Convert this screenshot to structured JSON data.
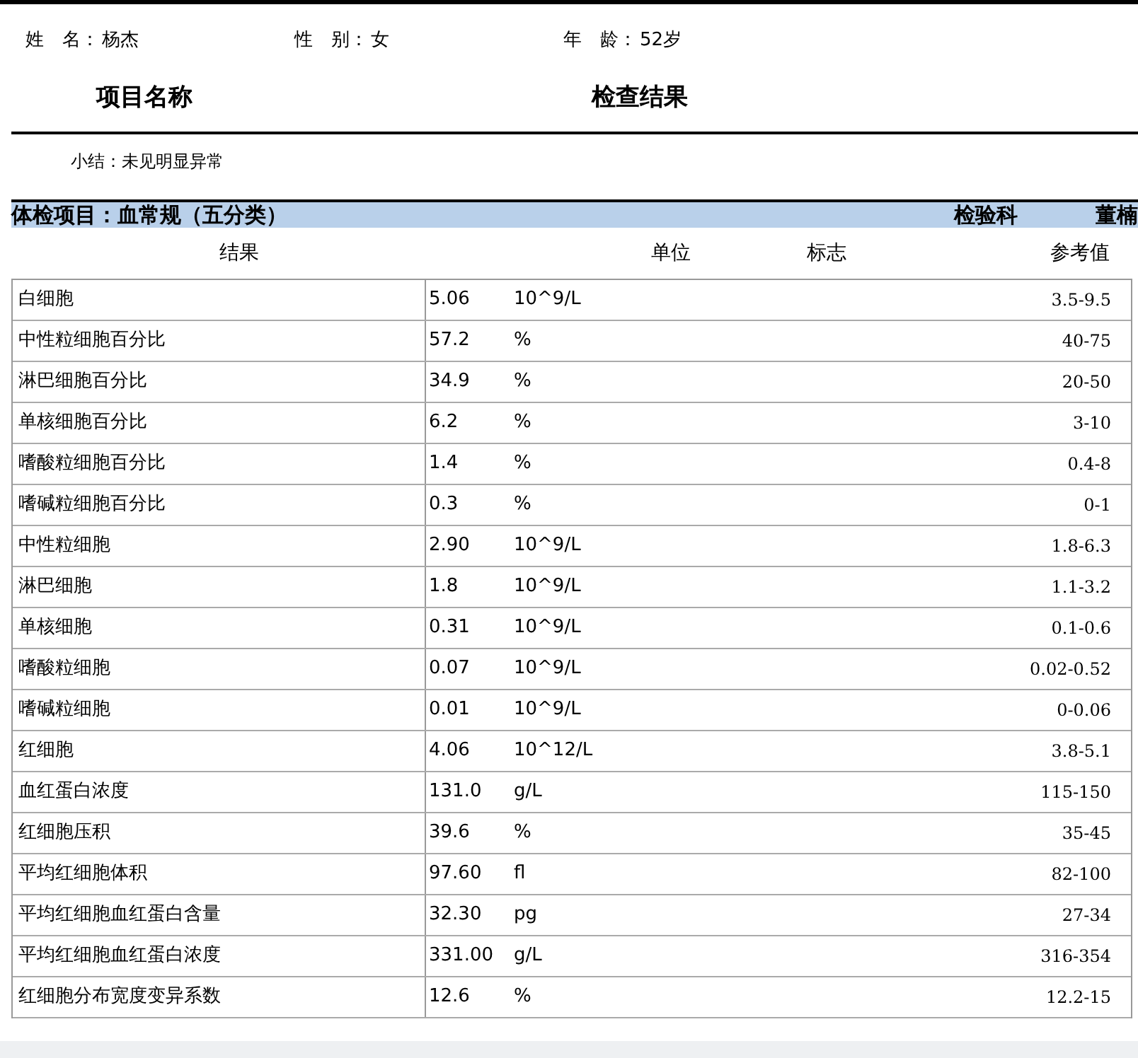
{
  "patient": [
    {
      "label": "姓　名：",
      "value": "杨杰"
    },
    {
      "label": "性　别：",
      "value": "女"
    },
    {
      "label": "年　龄：",
      "value": "52岁"
    }
  ],
  "headings": [
    "项目名称",
    "检查结果"
  ],
  "summary": "小结：未见明显异常",
  "section": {
    "title": "体检项目：血常规（五分类）",
    "department": "检验科",
    "doctor": "董楠"
  },
  "columns": [
    "结果",
    "单位",
    "标志",
    "参考值"
  ],
  "rows": [
    {
      "name": "白细胞",
      "value": "5.06",
      "unit": "10^9/L",
      "reference": "3.5-9.5"
    },
    {
      "name": "中性粒细胞百分比",
      "value": "57.2",
      "unit": "%",
      "reference": "40-75"
    },
    {
      "name": "淋巴细胞百分比",
      "value": "34.9",
      "unit": "%",
      "reference": "20-50"
    },
    {
      "name": "单核细胞百分比",
      "value": "6.2",
      "unit": "%",
      "reference": "3-10"
    },
    {
      "name": "嗜酸粒细胞百分比",
      "value": "1.4",
      "unit": "%",
      "reference": "0.4-8"
    },
    {
      "name": "嗜碱粒细胞百分比",
      "value": "0.3",
      "unit": "%",
      "reference": "0-1"
    },
    {
      "name": "中性粒细胞",
      "value": "2.90",
      "unit": "10^9/L",
      "reference": "1.8-6.3"
    },
    {
      "name": "淋巴细胞",
      "value": "1.8",
      "unit": "10^9/L",
      "reference": "1.1-3.2"
    },
    {
      "name": "单核细胞",
      "value": "0.31",
      "unit": "10^9/L",
      "reference": "0.1-0.6"
    },
    {
      "name": "嗜酸粒细胞",
      "value": "0.07",
      "unit": "10^9/L",
      "reference": "0.02-0.52"
    },
    {
      "name": "嗜碱粒细胞",
      "value": "0.01",
      "unit": "10^9/L",
      "reference": "0-0.06"
    },
    {
      "name": "红细胞",
      "value": "4.06",
      "unit": "10^12/L",
      "reference": "3.8-5.1"
    },
    {
      "name": "血红蛋白浓度",
      "value": "131.0",
      "unit": "g/L",
      "reference": "115-150"
    },
    {
      "name": "红细胞压积",
      "value": "39.6",
      "unit": "%",
      "reference": "35-45"
    },
    {
      "name": "平均红细胞体积",
      "value": "97.60",
      "unit": "fl",
      "reference": "82-100"
    },
    {
      "name": "平均红细胞血红蛋白含量",
      "value": "32.30",
      "unit": "pg",
      "reference": "27-34"
    },
    {
      "name": "平均红细胞血红蛋白浓度",
      "value": "331.00",
      "unit": "g/L",
      "reference": "316-354"
    },
    {
      "name": "红细胞分布宽度变异系数",
      "value": "12.6",
      "unit": "%",
      "reference": "12.2-15"
    }
  ]
}
